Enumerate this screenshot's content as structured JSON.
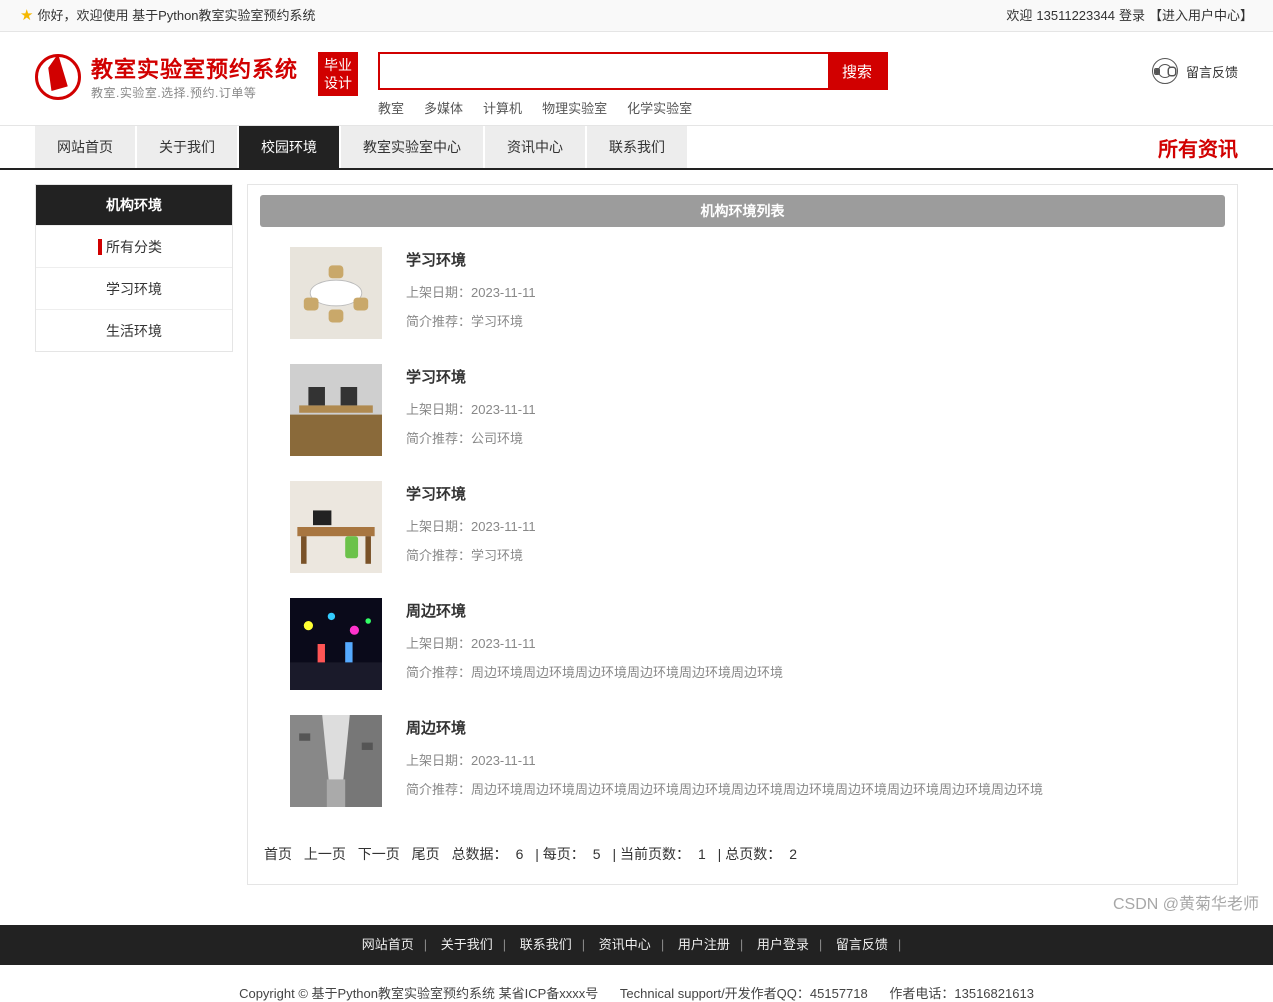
{
  "topbar": {
    "greeting": "你好，欢迎使用 基于Python教室实验室预约系统",
    "welcome_prefix": "欢迎 ",
    "phone": "13511223344",
    "login_suffix": " 登录 ",
    "user_center": "【进入用户中心】"
  },
  "header": {
    "logo_title": "教室实验室预约系统",
    "logo_sub": "教室.实验室.选择.预约.订单等",
    "badge_l1": "毕业",
    "badge_l2": "设计",
    "search_button": "搜索",
    "search_placeholder": "",
    "tags": [
      "教室",
      "多媒体",
      "计算机",
      "物理实验室",
      "化学实验室"
    ],
    "feedback": "留言反馈"
  },
  "nav": {
    "items": [
      "网站首页",
      "关于我们",
      "校园环境",
      "教室实验室中心",
      "资讯中心",
      "联系我们"
    ],
    "active_index": 2,
    "right": "所有资讯"
  },
  "sidebar": {
    "title": "机构环境",
    "items": [
      "所有分类",
      "学习环境",
      "生活环境"
    ],
    "active_index": 0
  },
  "content": {
    "title": "机构环境列表",
    "date_label": "上架日期：",
    "desc_label": "简介推荐：",
    "items": [
      {
        "title": "学习环境",
        "date": "2023-11-11",
        "desc": "学习环境",
        "thumb": "room-table"
      },
      {
        "title": "学习环境",
        "date": "2023-11-11",
        "desc": "公司环境",
        "thumb": "office-desk"
      },
      {
        "title": "学习环境",
        "date": "2023-11-11",
        "desc": "学习环境",
        "thumb": "study-desk"
      },
      {
        "title": "周边环境",
        "date": "2023-11-11",
        "desc": "周边环境周边环境周边环境周边环境周边环境周边环境",
        "thumb": "night-street"
      },
      {
        "title": "周边环境",
        "date": "2023-11-11",
        "desc": "周边环境周边环境周边环境周边环境周边环境周边环境周边环境周边环境周边环境周边环境周边环境",
        "thumb": "alley-bw"
      }
    ]
  },
  "pager": {
    "first": "首页",
    "prev": "上一页",
    "next": "下一页",
    "last": "尾页",
    "total_label": "总数据：",
    "total": "6",
    "per_label": "每页：",
    "per": "5",
    "cur_label": "当前页数：",
    "cur": "1",
    "pages_label": "总页数：",
    "pages": "2"
  },
  "footer": {
    "links": [
      "网站首页",
      "关于我们",
      "联系我们",
      "资讯中心",
      "用户注册",
      "用户登录",
      "留言反馈"
    ],
    "copyright_a": "Copyright © 基于Python教室实验室预约系统 某省ICP备xxxx号",
    "copyright_b": "Technical support/开发作者QQ：45157718",
    "copyright_c": "作者电话：13516821613"
  },
  "watermark": "CSDN @黄菊华老师"
}
